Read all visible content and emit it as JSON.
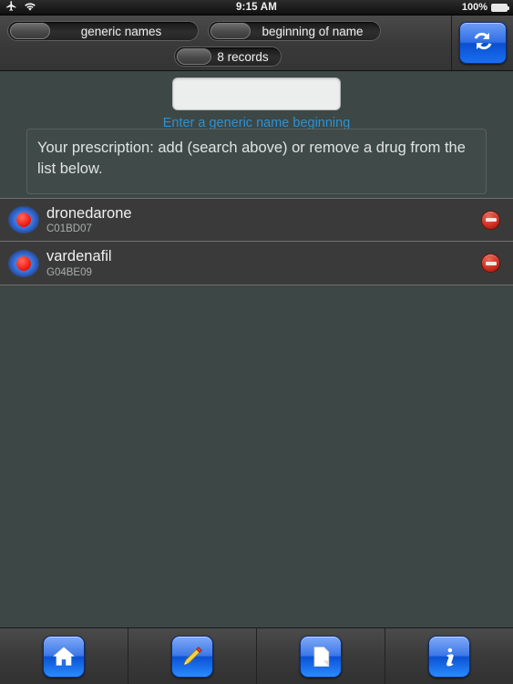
{
  "status_bar": {
    "airplane_icon": "airplane-icon",
    "wifi_icon": "wifi-icon",
    "time": "9:15 AM",
    "battery_percent": "100%",
    "battery_icon": "battery-full-icon"
  },
  "toolbar": {
    "switches": [
      {
        "label": "generic names",
        "state": "off"
      },
      {
        "label": "beginning of name",
        "state": "off"
      },
      {
        "label": "8 records",
        "state": "off"
      }
    ],
    "sync_button": {
      "icon": "sync-refresh-icon",
      "label": ""
    }
  },
  "search": {
    "value": "",
    "placeholder": "",
    "hint": "Enter a generic name beginning",
    "hint_color": "#2b92d4"
  },
  "panel": {
    "text": "Your prescription: add (search above) or remove a drug from the list below."
  },
  "list": {
    "rows": [
      {
        "name": "dronedarone",
        "code": "C01BD07",
        "marker_icon": "red-dot-icon",
        "remove_icon": "minus-circle-icon"
      },
      {
        "name": "vardenafil",
        "code": "G04BE09",
        "marker_icon": "red-dot-icon",
        "remove_icon": "minus-circle-icon"
      }
    ]
  },
  "tabbar": {
    "tabs": [
      {
        "name": "home",
        "icon": "home-icon"
      },
      {
        "name": "edit",
        "icon": "pencil-icon"
      },
      {
        "name": "notes",
        "icon": "document-icon"
      },
      {
        "name": "info",
        "icon": "info-icon"
      }
    ]
  },
  "colors": {
    "accent_blue": "#2b92d4",
    "button_blue": "#1a6ff0",
    "remove_red": "#c92b1c",
    "background": "#3d4745",
    "row_background": "#3a3a3a"
  }
}
